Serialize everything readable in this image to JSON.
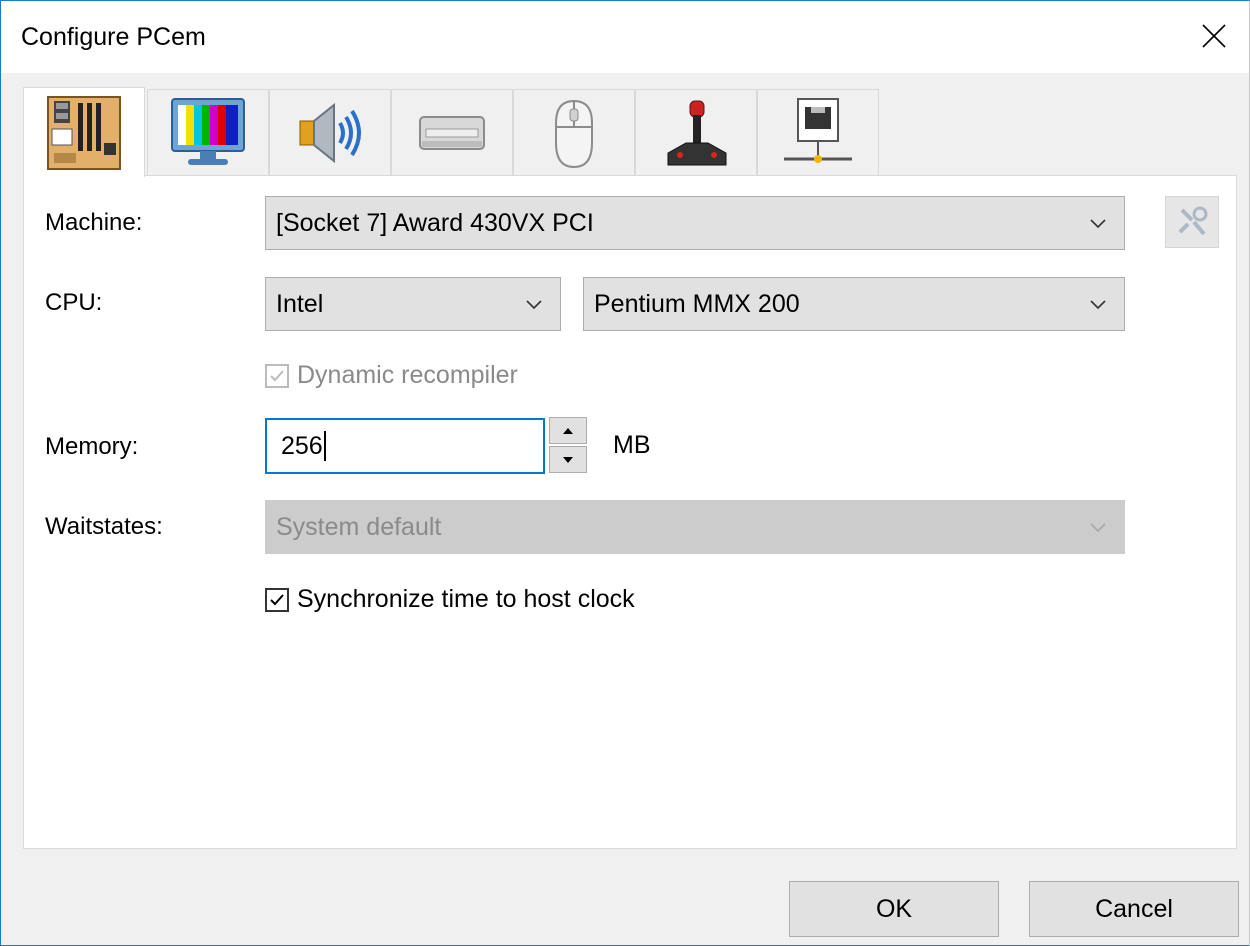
{
  "window": {
    "title": "Configure PCem"
  },
  "tabs": [
    {
      "name": "motherboard-icon",
      "active": true
    },
    {
      "name": "display-monitor-icon",
      "active": false
    },
    {
      "name": "speaker-sound-icon",
      "active": false
    },
    {
      "name": "drive-icon",
      "active": false
    },
    {
      "name": "mouse-icon",
      "active": false
    },
    {
      "name": "joystick-icon",
      "active": false
    },
    {
      "name": "network-icon",
      "active": false
    }
  ],
  "machine": {
    "label": "Machine:",
    "value": "[Socket 7] Award 430VX PCI"
  },
  "cpu": {
    "label": "CPU:",
    "manufacturer": "Intel",
    "model": "Pentium MMX 200"
  },
  "dynamic_recompiler": {
    "label": "Dynamic recompiler",
    "checked": true,
    "disabled": true
  },
  "memory": {
    "label": "Memory:",
    "value": "256",
    "unit": "MB"
  },
  "waitstates": {
    "label": "Waitstates:",
    "value": "System default",
    "disabled": true
  },
  "sync_clock": {
    "label": "Synchronize time to host clock",
    "checked": true
  },
  "buttons": {
    "ok": "OK",
    "cancel": "Cancel"
  },
  "colors": {
    "accent": "#0078d7",
    "window_border": "#1979ca"
  }
}
